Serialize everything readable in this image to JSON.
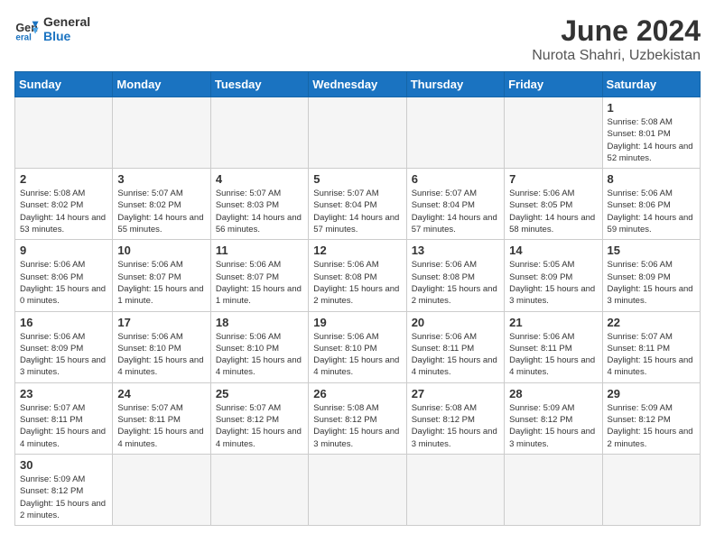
{
  "header": {
    "logo_general": "General",
    "logo_blue": "Blue",
    "month_year": "June 2024",
    "location": "Nurota Shahri, Uzbekistan"
  },
  "weekdays": [
    "Sunday",
    "Monday",
    "Tuesday",
    "Wednesday",
    "Thursday",
    "Friday",
    "Saturday"
  ],
  "weeks": [
    [
      {
        "day": "",
        "info": ""
      },
      {
        "day": "",
        "info": ""
      },
      {
        "day": "",
        "info": ""
      },
      {
        "day": "",
        "info": ""
      },
      {
        "day": "",
        "info": ""
      },
      {
        "day": "",
        "info": ""
      },
      {
        "day": "1",
        "info": "Sunrise: 5:08 AM\nSunset: 8:01 PM\nDaylight: 14 hours\nand 52 minutes."
      }
    ],
    [
      {
        "day": "2",
        "info": "Sunrise: 5:08 AM\nSunset: 8:02 PM\nDaylight: 14 hours\nand 53 minutes."
      },
      {
        "day": "3",
        "info": "Sunrise: 5:07 AM\nSunset: 8:02 PM\nDaylight: 14 hours\nand 55 minutes."
      },
      {
        "day": "4",
        "info": "Sunrise: 5:07 AM\nSunset: 8:03 PM\nDaylight: 14 hours\nand 56 minutes."
      },
      {
        "day": "5",
        "info": "Sunrise: 5:07 AM\nSunset: 8:04 PM\nDaylight: 14 hours\nand 57 minutes."
      },
      {
        "day": "6",
        "info": "Sunrise: 5:07 AM\nSunset: 8:04 PM\nDaylight: 14 hours\nand 57 minutes."
      },
      {
        "day": "7",
        "info": "Sunrise: 5:06 AM\nSunset: 8:05 PM\nDaylight: 14 hours\nand 58 minutes."
      },
      {
        "day": "8",
        "info": "Sunrise: 5:06 AM\nSunset: 8:06 PM\nDaylight: 14 hours\nand 59 minutes."
      }
    ],
    [
      {
        "day": "9",
        "info": "Sunrise: 5:06 AM\nSunset: 8:06 PM\nDaylight: 15 hours\nand 0 minutes."
      },
      {
        "day": "10",
        "info": "Sunrise: 5:06 AM\nSunset: 8:07 PM\nDaylight: 15 hours\nand 1 minute."
      },
      {
        "day": "11",
        "info": "Sunrise: 5:06 AM\nSunset: 8:07 PM\nDaylight: 15 hours\nand 1 minute."
      },
      {
        "day": "12",
        "info": "Sunrise: 5:06 AM\nSunset: 8:08 PM\nDaylight: 15 hours\nand 2 minutes."
      },
      {
        "day": "13",
        "info": "Sunrise: 5:06 AM\nSunset: 8:08 PM\nDaylight: 15 hours\nand 2 minutes."
      },
      {
        "day": "14",
        "info": "Sunrise: 5:05 AM\nSunset: 8:09 PM\nDaylight: 15 hours\nand 3 minutes."
      },
      {
        "day": "15",
        "info": "Sunrise: 5:06 AM\nSunset: 8:09 PM\nDaylight: 15 hours\nand 3 minutes."
      }
    ],
    [
      {
        "day": "16",
        "info": "Sunrise: 5:06 AM\nSunset: 8:09 PM\nDaylight: 15 hours\nand 3 minutes."
      },
      {
        "day": "17",
        "info": "Sunrise: 5:06 AM\nSunset: 8:10 PM\nDaylight: 15 hours\nand 4 minutes."
      },
      {
        "day": "18",
        "info": "Sunrise: 5:06 AM\nSunset: 8:10 PM\nDaylight: 15 hours\nand 4 minutes."
      },
      {
        "day": "19",
        "info": "Sunrise: 5:06 AM\nSunset: 8:10 PM\nDaylight: 15 hours\nand 4 minutes."
      },
      {
        "day": "20",
        "info": "Sunrise: 5:06 AM\nSunset: 8:11 PM\nDaylight: 15 hours\nand 4 minutes."
      },
      {
        "day": "21",
        "info": "Sunrise: 5:06 AM\nSunset: 8:11 PM\nDaylight: 15 hours\nand 4 minutes."
      },
      {
        "day": "22",
        "info": "Sunrise: 5:07 AM\nSunset: 8:11 PM\nDaylight: 15 hours\nand 4 minutes."
      }
    ],
    [
      {
        "day": "23",
        "info": "Sunrise: 5:07 AM\nSunset: 8:11 PM\nDaylight: 15 hours\nand 4 minutes."
      },
      {
        "day": "24",
        "info": "Sunrise: 5:07 AM\nSunset: 8:11 PM\nDaylight: 15 hours\nand 4 minutes."
      },
      {
        "day": "25",
        "info": "Sunrise: 5:07 AM\nSunset: 8:12 PM\nDaylight: 15 hours\nand 4 minutes."
      },
      {
        "day": "26",
        "info": "Sunrise: 5:08 AM\nSunset: 8:12 PM\nDaylight: 15 hours\nand 3 minutes."
      },
      {
        "day": "27",
        "info": "Sunrise: 5:08 AM\nSunset: 8:12 PM\nDaylight: 15 hours\nand 3 minutes."
      },
      {
        "day": "28",
        "info": "Sunrise: 5:09 AM\nSunset: 8:12 PM\nDaylight: 15 hours\nand 3 minutes."
      },
      {
        "day": "29",
        "info": "Sunrise: 5:09 AM\nSunset: 8:12 PM\nDaylight: 15 hours\nand 2 minutes."
      }
    ],
    [
      {
        "day": "30",
        "info": "Sunrise: 5:09 AM\nSunset: 8:12 PM\nDaylight: 15 hours\nand 2 minutes."
      },
      {
        "day": "",
        "info": ""
      },
      {
        "day": "",
        "info": ""
      },
      {
        "day": "",
        "info": ""
      },
      {
        "day": "",
        "info": ""
      },
      {
        "day": "",
        "info": ""
      },
      {
        "day": "",
        "info": ""
      }
    ]
  ]
}
